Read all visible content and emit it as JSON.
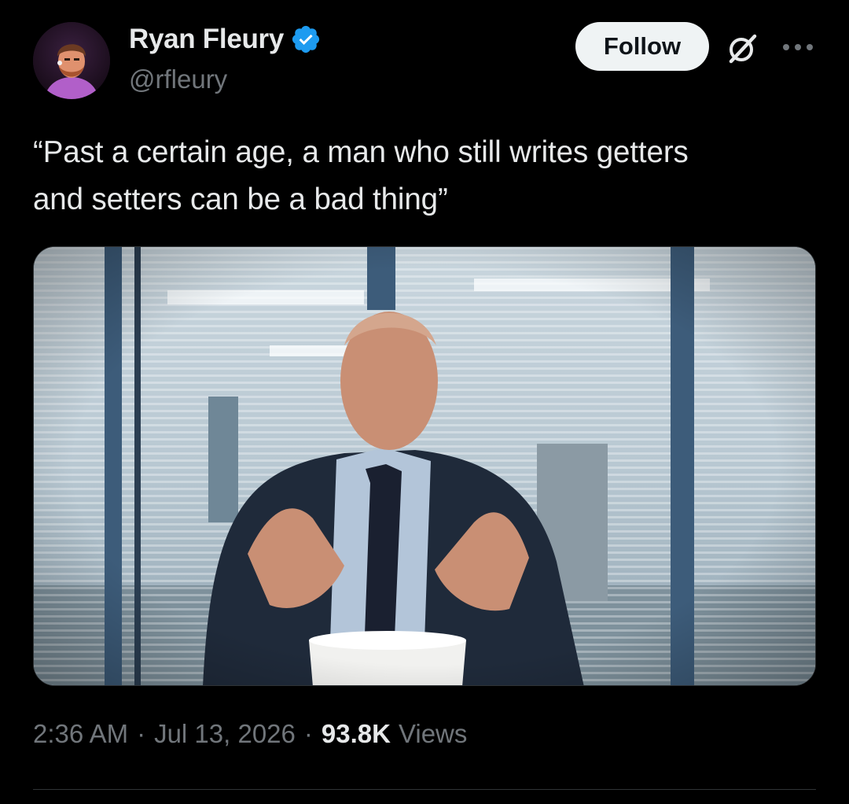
{
  "author": {
    "display_name": "Ryan Fleury",
    "handle": "@rfleury",
    "verified": true
  },
  "actions": {
    "follow_label": "Follow",
    "grok_icon": "grok-icon",
    "more_icon": "more-options-icon"
  },
  "tweet": {
    "text": "“Past a certain age, a man who still writes getters\nand setters can be a bad thing”"
  },
  "meta": {
    "time": "2:36 AM",
    "separator": "·",
    "date": "Jul 13, 2026",
    "views_count": "93.8K",
    "views_label": "Views"
  },
  "colors": {
    "background": "#000000",
    "text_primary": "#e7e9ea",
    "text_secondary": "#71767b",
    "verified_blue": "#1d9bf0",
    "follow_bg": "#eff3f4",
    "divider": "#2f3336"
  }
}
